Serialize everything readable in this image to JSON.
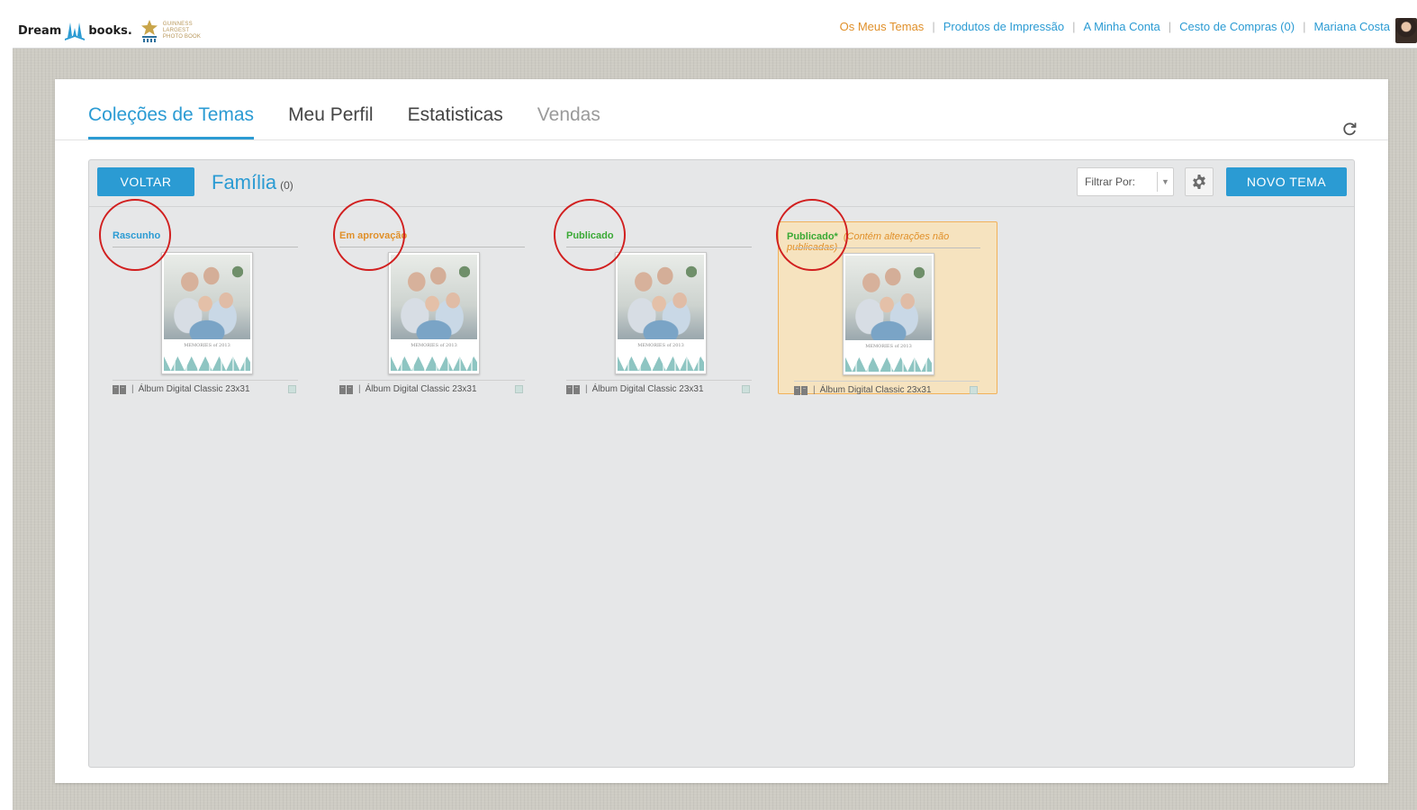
{
  "header": {
    "logo": {
      "part1": "Dream",
      "part2": "books.",
      "badge_lines": [
        "GUINNESS",
        "LARGEST",
        "PHOTO BOOK"
      ]
    },
    "nav": [
      {
        "label": "Os Meus Temas",
        "active": true
      },
      {
        "label": "Produtos de Impressão",
        "active": false
      },
      {
        "label": "A Minha Conta",
        "active": false
      },
      {
        "label": "Cesto de Compras (0)",
        "active": false
      },
      {
        "label": "Mariana Costa",
        "active": false
      }
    ]
  },
  "tabs": [
    {
      "label": "Coleções de Temas",
      "state": "active"
    },
    {
      "label": "Meu Perfil",
      "state": "normal"
    },
    {
      "label": "Estatisticas",
      "state": "normal"
    },
    {
      "label": "Vendas",
      "state": "disabled"
    }
  ],
  "panel": {
    "back_label": "VOLTAR",
    "title": "Família",
    "count": "(0)",
    "filter_placeholder": "Filtrar Por:",
    "new_label": "NOVO TEMA"
  },
  "themes": [
    {
      "status": "Rascunho",
      "note": "",
      "caption": "MEMORIES of 2013",
      "product": "Álbum Digital Classic 23x31"
    },
    {
      "status": "Em aprovação",
      "note": "",
      "caption": "MEMORIES of 2013",
      "product": "Álbum Digital Classic 23x31"
    },
    {
      "status": "Publicado",
      "note": "",
      "caption": "MEMORIES of 2013",
      "product": "Álbum Digital Classic 23x31"
    },
    {
      "status": "Publicado*",
      "note": "(Contém alterações não publicadas)",
      "caption": "MEMORIES of 2013",
      "product": "Álbum Digital Classic 23x31"
    }
  ],
  "colors": {
    "accent_blue": "#2b9bd3",
    "accent_orange": "#e0902a",
    "status_green": "#3aa935",
    "annotation_red": "#d11f1f",
    "modified_card_bg": "#f6e3bf"
  },
  "icons": [
    "refresh-icon",
    "gear-icon",
    "book-icon",
    "chevron-down-icon",
    "guinness-star-icon"
  ]
}
